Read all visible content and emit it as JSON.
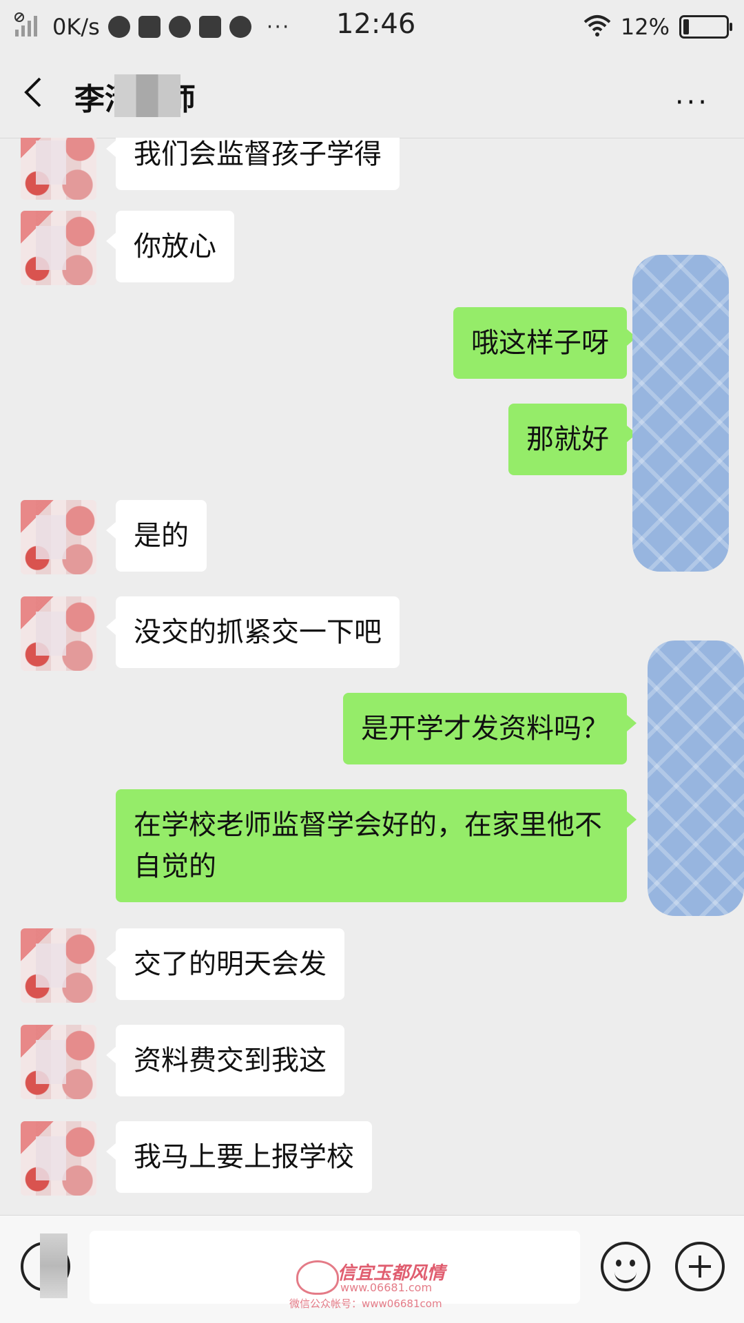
{
  "status_bar": {
    "net_speed": "0K/s",
    "time": "12:46",
    "battery_percent": "12%",
    "battery_level": 0.12,
    "more": "···"
  },
  "header": {
    "title": "李清老师",
    "back_icon": "chevron-left-icon",
    "more_icon": "ellipsis-icon",
    "more_label": "···"
  },
  "messages": [
    {
      "dir": "in",
      "text": "我们会监督孩子学得"
    },
    {
      "dir": "in",
      "text": "你放心"
    },
    {
      "dir": "out",
      "text": "哦这样子呀"
    },
    {
      "dir": "out",
      "text": "那就好"
    },
    {
      "dir": "in",
      "text": "是的"
    },
    {
      "dir": "in",
      "text": "没交的抓紧交一下吧"
    },
    {
      "dir": "out",
      "text": "是开学才发资料吗？"
    },
    {
      "dir": "out",
      "text": "在学校老师监督学会好的，在家里他不自觉的"
    },
    {
      "dir": "in",
      "text": "交了的明天会发"
    },
    {
      "dir": "in",
      "text": "资料费交到我这"
    },
    {
      "dir": "in",
      "text": "我马上要上报学校"
    }
  ],
  "input_bar": {
    "voice_icon": "voice-icon",
    "emoji_icon": "emoji-icon",
    "plus_icon": "plus-icon"
  },
  "watermark": {
    "line1": "信宜玉都风情",
    "line2": "www.06681.com",
    "line3": "微信公众帐号：www06681com"
  },
  "colors": {
    "background": "#ededed",
    "incoming_bubble": "#ffffff",
    "outgoing_bubble": "#95ec69",
    "scribble": "#97b5df"
  }
}
